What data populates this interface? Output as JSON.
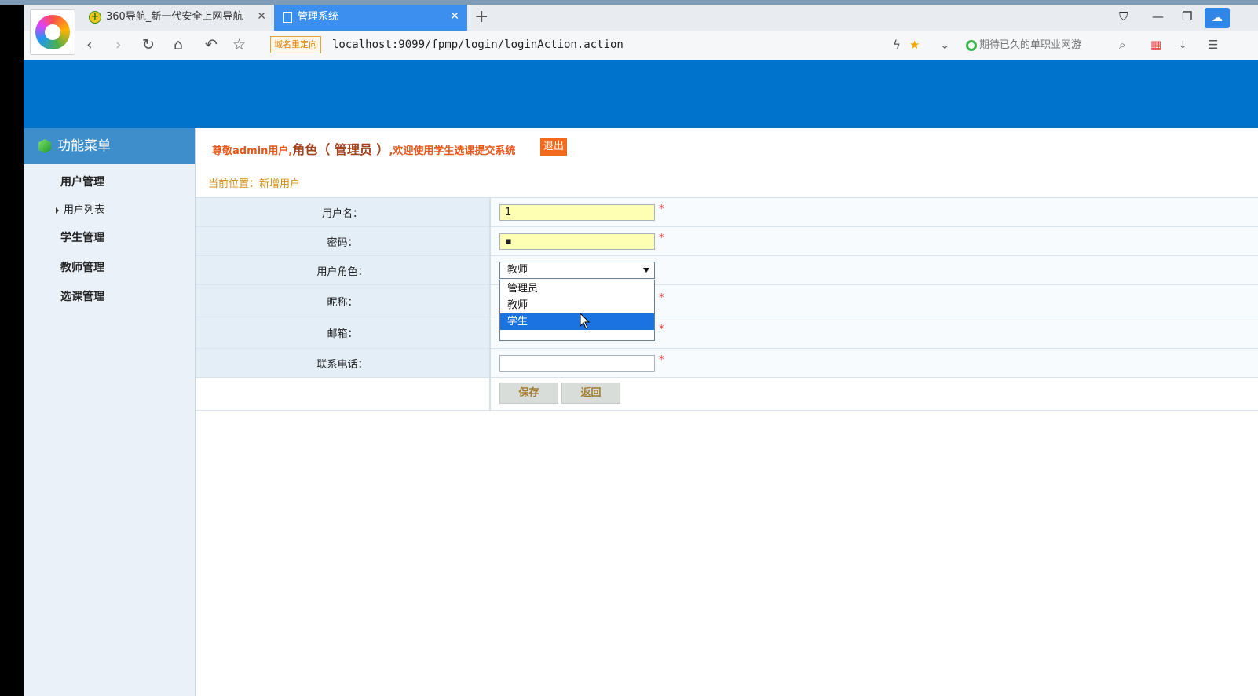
{
  "browser": {
    "tabs": [
      {
        "label": "360导航_新一代安全上网导航",
        "icon": "plus-shield-icon"
      },
      {
        "label": "管理系统",
        "icon": "page-icon"
      }
    ],
    "redirect_badge": "域名重定向",
    "url": "localhost:9099/fpmp/login/loginAction.action",
    "news_text": "期待已久的单职业网游"
  },
  "sidebar": {
    "title": "功能菜单",
    "items": [
      {
        "label": "用户管理"
      },
      {
        "label": "用户列表"
      },
      {
        "label": "学生管理"
      },
      {
        "label": "教师管理"
      },
      {
        "label": "选课管理"
      }
    ]
  },
  "header": {
    "welcome_prefix": "尊敬admin用户,",
    "welcome_role": "角色（ 管理员 ）",
    "welcome_suffix": ",欢迎使用学生选课提交系统",
    "logout": "退出",
    "breadcrumb": "当前位置：新增用户"
  },
  "form": {
    "username_label": "用户名：",
    "username_value": "1",
    "password_label": "密码：",
    "password_value": "▪",
    "role_label": "用户角色：",
    "role_value": "教师",
    "role_options": [
      "管理员",
      "教师",
      "学生"
    ],
    "nickname_label": "昵称：",
    "email_label": "邮箱：",
    "phone_label": "联系电话：",
    "required_mark": "*",
    "save": "保存",
    "back": "返回"
  },
  "colors": {
    "banner": "#0073cc",
    "sidebar_header": "#3d8ecb",
    "active_tab": "#3d8fef",
    "welcome_text": "#e8561a",
    "logout_bg": "#f26a1b",
    "breadcrumb": "#d09019",
    "option_highlight": "#1a73e0"
  }
}
